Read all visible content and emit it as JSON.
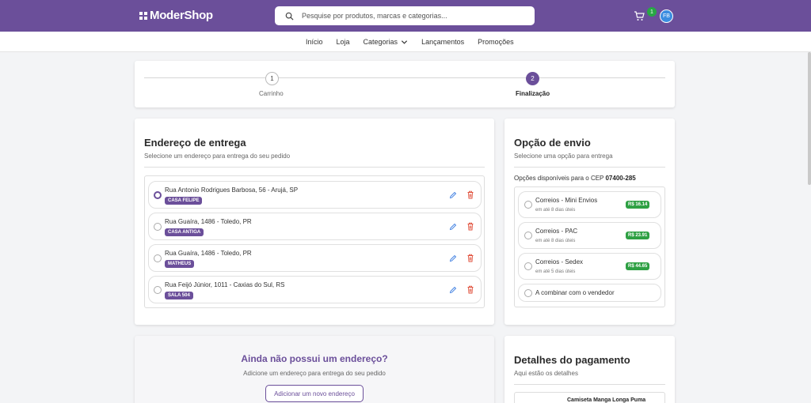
{
  "header": {
    "logo_text": "ModerShop",
    "search_placeholder": "Pesquise por produtos, marcas e categorias...",
    "cart_count": "1",
    "avatar_initials": "FB",
    "brand_color": "#6b4f9a"
  },
  "nav": {
    "items": [
      "Início",
      "Loja",
      "Categorias",
      "Lançamentos",
      "Promoções"
    ]
  },
  "stepper": {
    "steps": [
      {
        "number": "1",
        "label": "Carrinho",
        "active": false
      },
      {
        "number": "2",
        "label": "Finalização",
        "active": true
      }
    ]
  },
  "address": {
    "title": "Endereço de entrega",
    "subtitle": "Selecione um endereço para entrega do seu pedido",
    "items": [
      {
        "text": "Rua Antonio Rodrigues Barbosa, 56 - Arujá, SP",
        "badge": "CASA FELIPE",
        "selected": true
      },
      {
        "text": "Rua Guaíra, 1486 - Toledo, PR",
        "badge": "CASA ANTIGA",
        "selected": false
      },
      {
        "text": "Rua Guaíra, 1486 - Toledo, PR",
        "badge": "MATHEUS",
        "selected": false
      },
      {
        "text": "Rua Feijó Júnior, 1011 - Caxias do Sul, RS",
        "badge": "SALA 504",
        "selected": false
      }
    ]
  },
  "shipping": {
    "title": "Opção de envio",
    "subtitle": "Selecione uma opção para entrega",
    "cep_prefix": "Opções disponíveis para o CEP",
    "cep": "07400-285",
    "options": [
      {
        "name": "Correios - Mini Envios",
        "eta": "em até 8 dias úteis",
        "price": "R$ 16.14"
      },
      {
        "name": "Correios - PAC",
        "eta": "em até 8 dias úteis",
        "price": "R$ 23.91"
      },
      {
        "name": "Correios - Sedex",
        "eta": "em até 5 dias úteis",
        "price": "R$ 44.65"
      }
    ],
    "combine_label": "A combinar com o vendedor"
  },
  "no_address": {
    "title": "Ainda não possui um endereço?",
    "subtitle": "Adicione um endereço para entrega do seu pedido",
    "button": "Adicionar um novo endereço"
  },
  "payment": {
    "title": "Detalhes do pagamento",
    "subtitle": "Aqui estão os detalhes",
    "product_name": "Camiseta Manga Longa Puma"
  }
}
